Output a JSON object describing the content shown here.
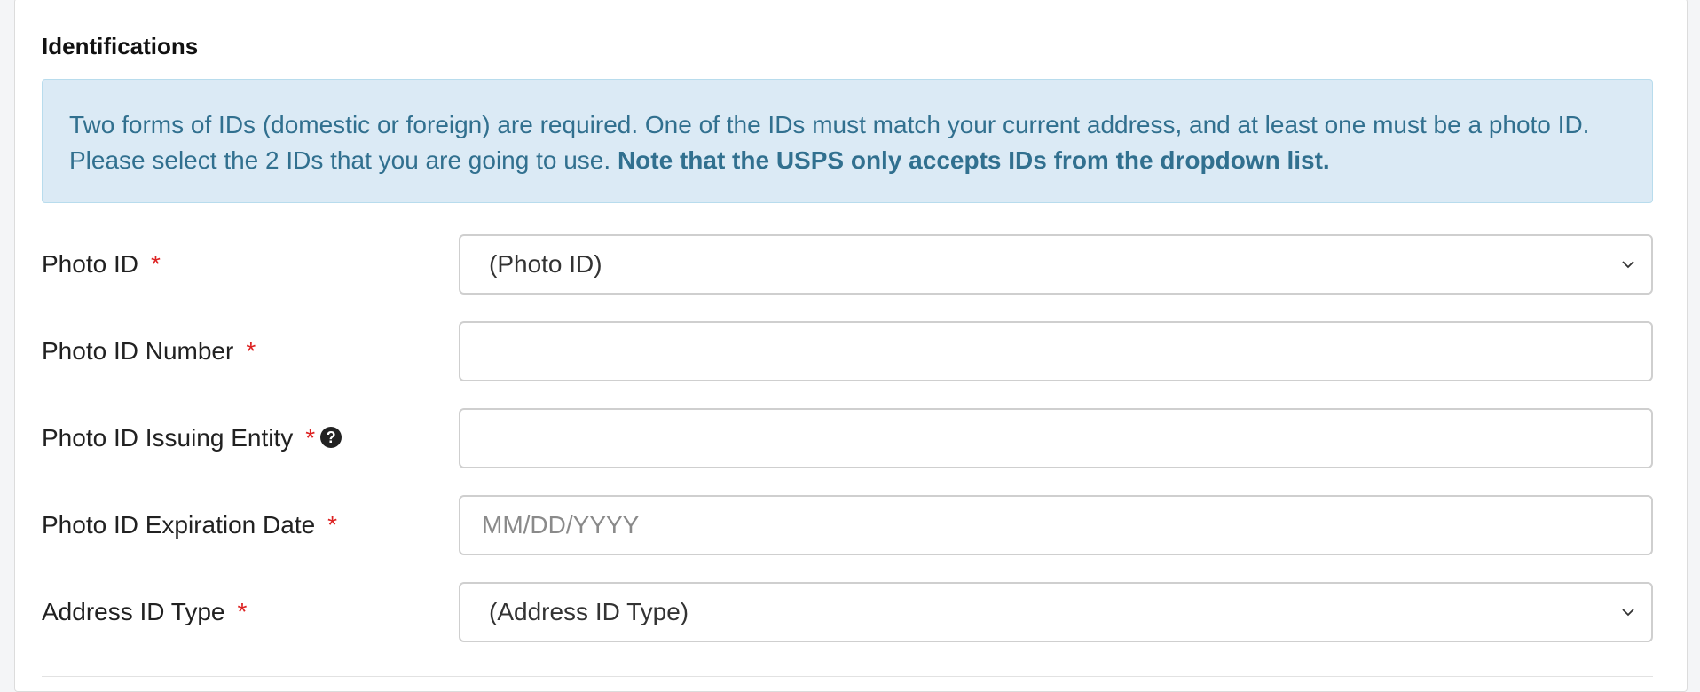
{
  "section": {
    "title": "Identifications"
  },
  "notice": {
    "text": "Two forms of IDs (domestic or foreign) are required. One of the IDs must match your current address, and at least one must be a photo ID. Please select the 2 IDs that you are going to use. ",
    "bold_text": "Note that the USPS only accepts IDs from the dropdown list."
  },
  "form": {
    "required_mark": "*",
    "help_glyph": "?",
    "photo_id": {
      "label": "Photo ID",
      "selected": "(Photo ID)"
    },
    "photo_id_number": {
      "label": "Photo ID Number",
      "value": "",
      "placeholder": ""
    },
    "photo_id_issuing_entity": {
      "label": "Photo ID Issuing Entity",
      "value": "",
      "placeholder": ""
    },
    "photo_id_expiration_date": {
      "label": "Photo ID Expiration Date",
      "value": "",
      "placeholder": "MM/DD/YYYY"
    },
    "address_id_type": {
      "label": "Address ID Type",
      "selected": "(Address ID Type)"
    }
  },
  "icons": {
    "help": "question-circle-icon",
    "dropdown": "chevron-down-icon"
  },
  "colors": {
    "notice_bg": "#dbeaf5",
    "notice_text": "#31708f",
    "required": "#dd2222"
  }
}
